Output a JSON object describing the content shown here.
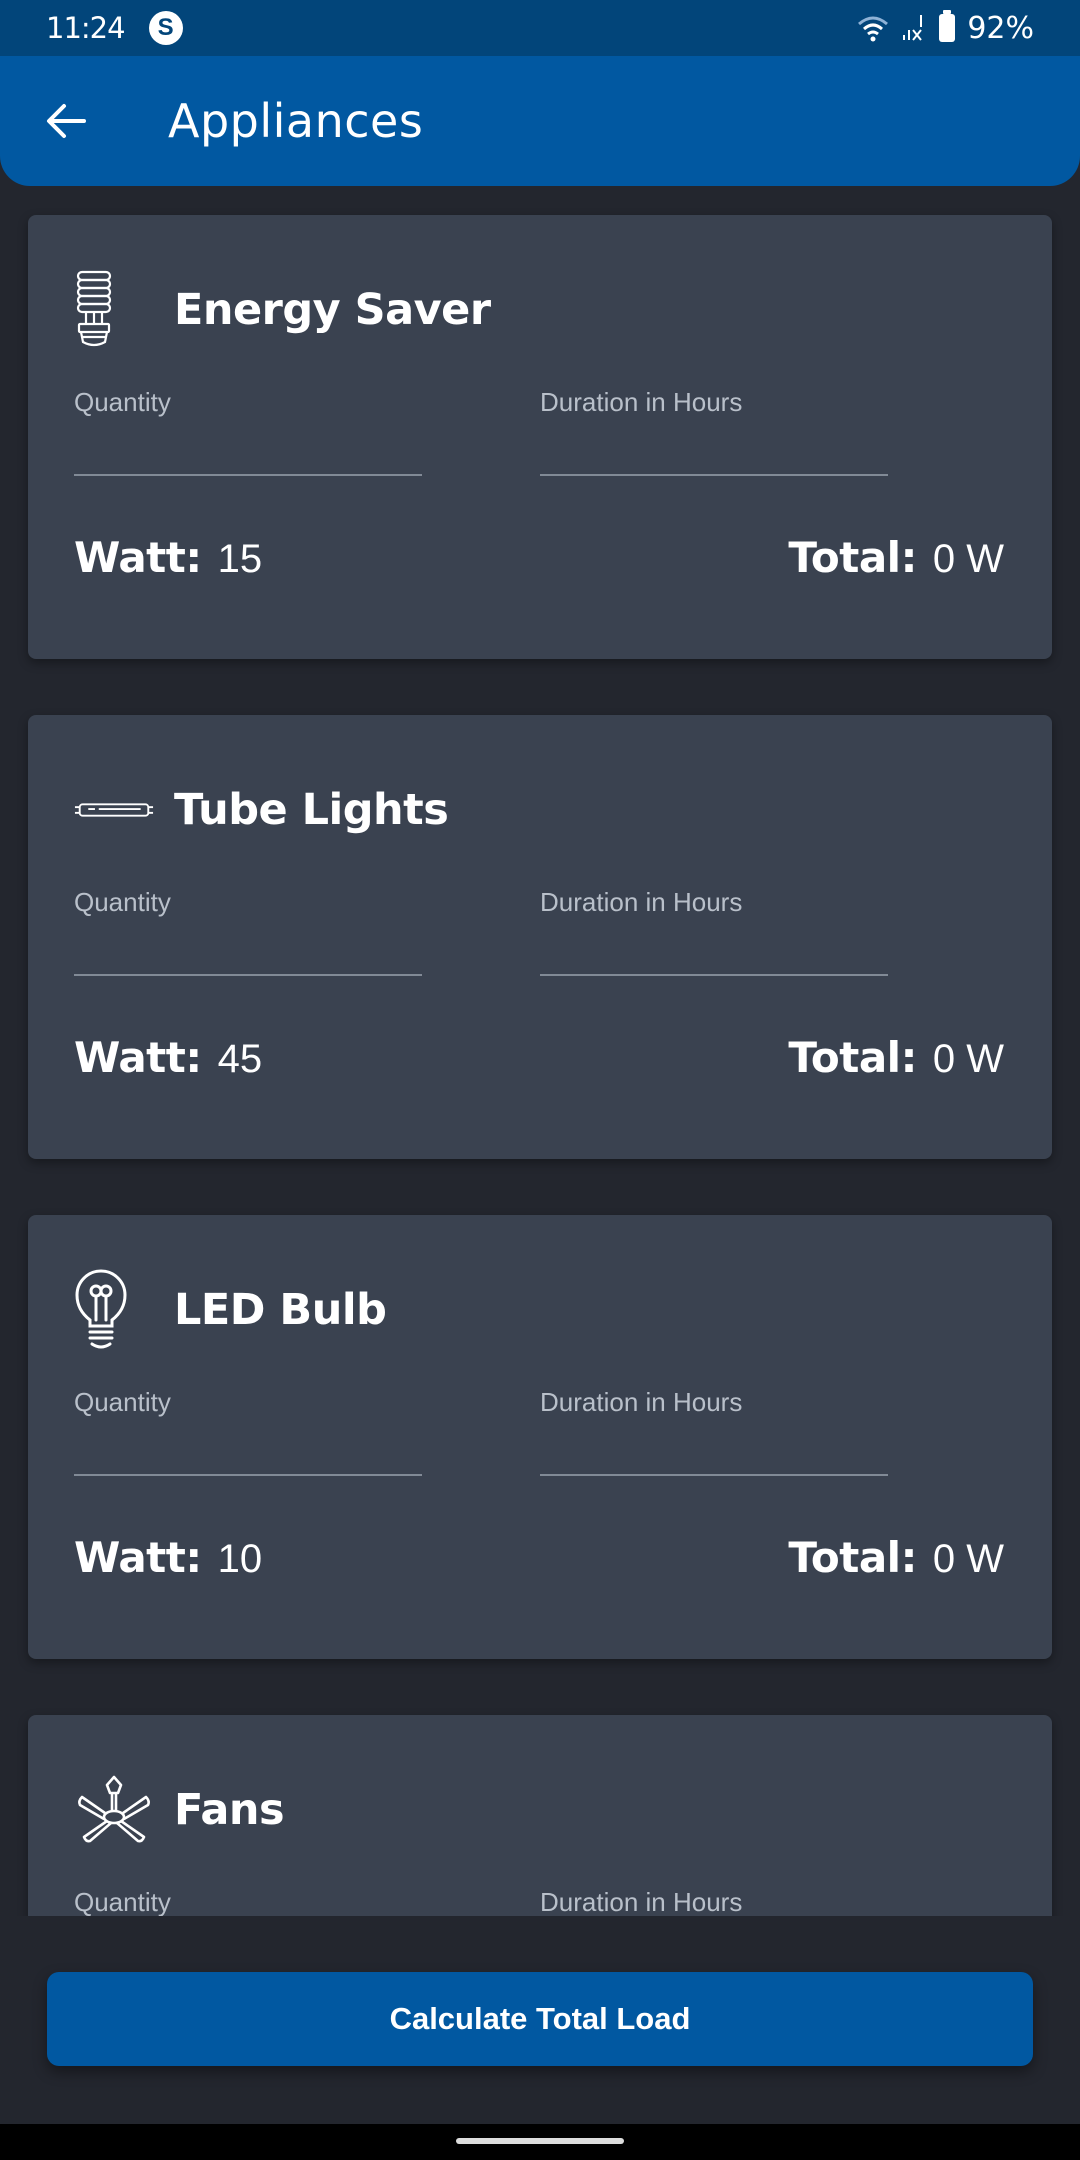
{
  "status_bar": {
    "time": "11:24",
    "app_notification_icon": "s-circle-icon",
    "wifi_icon": "wifi-icon",
    "signal_icon": "signal-no-service-icon",
    "battery_icon": "battery-icon",
    "battery_percent": "92%"
  },
  "app_bar": {
    "back_icon": "arrow-left-icon",
    "title": "Appliances"
  },
  "appliances": [
    {
      "name": "Energy Saver",
      "icon": "cfl-bulb-icon",
      "quantity_label": "Quantity",
      "quantity_value": "",
      "duration_label": "Duration in Hours",
      "duration_value": "",
      "watt_label": "Watt:",
      "watt_value": "15",
      "total_label": "Total:",
      "total_value": "0 W"
    },
    {
      "name": "Tube Lights",
      "icon": "tube-light-icon",
      "quantity_label": "Quantity",
      "quantity_value": "",
      "duration_label": "Duration in Hours",
      "duration_value": "",
      "watt_label": "Watt:",
      "watt_value": "45",
      "total_label": "Total:",
      "total_value": "0 W"
    },
    {
      "name": "LED Bulb",
      "icon": "light-bulb-icon",
      "quantity_label": "Quantity",
      "quantity_value": "",
      "duration_label": "Duration in Hours",
      "duration_value": "",
      "watt_label": "Watt:",
      "watt_value": "10",
      "total_label": "Total:",
      "total_value": "0 W"
    },
    {
      "name": "Fans",
      "icon": "ceiling-fan-icon",
      "quantity_label": "Quantity",
      "quantity_value": "",
      "duration_label": "Duration in Hours",
      "duration_value": ""
    }
  ],
  "footer": {
    "calculate_label": "Calculate Total Load"
  },
  "colors": {
    "status_bar": "#02457a",
    "primary": "#0158a1",
    "background": "#23262e",
    "card": "#3a4250"
  }
}
